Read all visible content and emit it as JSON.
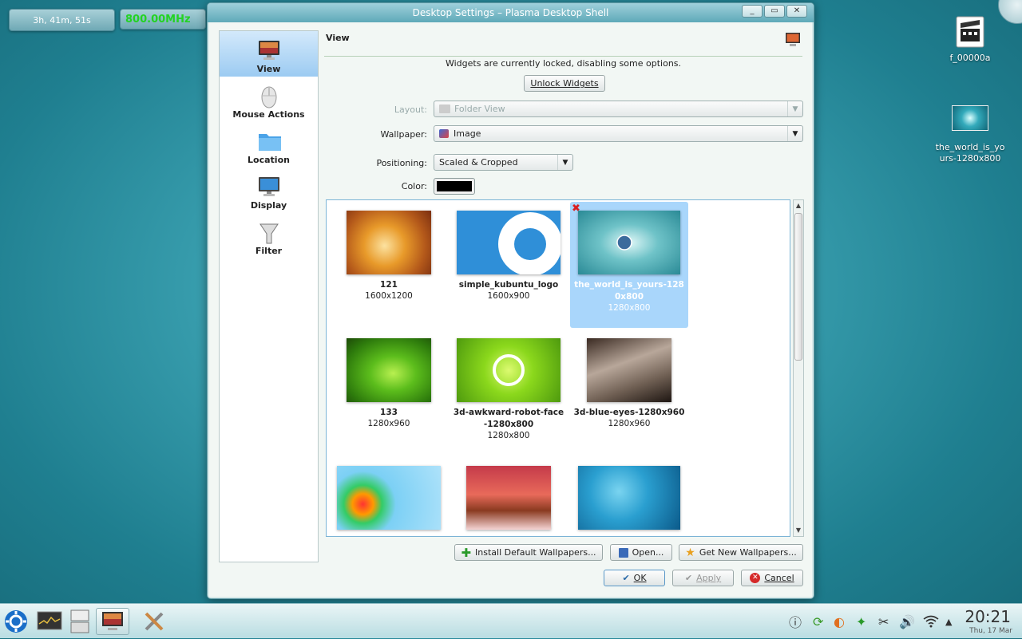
{
  "desktop": {
    "uptime": "3h, 41m, 51s",
    "cpu_freq": "800.00MHz",
    "icons": [
      {
        "label": "f_00000a"
      },
      {
        "label": "the_world_is_yours-1280x800"
      }
    ]
  },
  "dialog": {
    "title": "Desktop Settings – Plasma Desktop Shell",
    "nav": [
      {
        "label": "View",
        "icon": "monitor-icon",
        "active": true
      },
      {
        "label": "Mouse Actions",
        "icon": "mouse-icon"
      },
      {
        "label": "Location",
        "icon": "folder-icon"
      },
      {
        "label": "Display",
        "icon": "display-icon"
      },
      {
        "label": "Filter",
        "icon": "funnel-icon"
      }
    ],
    "page_title": "View",
    "locked_message": "Widgets are currently locked, disabling some options.",
    "unlock_button": "Unlock Widgets",
    "layout_label": "Layout:",
    "layout_value": "Folder View",
    "wallpaper_label": "Wallpaper:",
    "wallpaper_value": "Image",
    "positioning_label": "Positioning:",
    "positioning_value": "Scaled & Cropped",
    "color_label": "Color:",
    "color_value": "#000000",
    "wallpapers": [
      {
        "name": "121",
        "res": "1600x1200"
      },
      {
        "name": "simple_kubuntu_logo",
        "res": "1600x900"
      },
      {
        "name": "the_world_is_yours-1280x800",
        "res": "1280x800",
        "selected": true
      },
      {
        "name": "133",
        "res": "1280x960"
      },
      {
        "name": "3d-awkward-robot-face-1280x800",
        "res": "1280x800"
      },
      {
        "name": "3d-blue-eyes-1280x960",
        "res": "1280x960"
      },
      {
        "name": "",
        "res": ""
      },
      {
        "name": "",
        "res": ""
      },
      {
        "name": "",
        "res": ""
      }
    ],
    "install_button": "Install Default Wallpapers...",
    "open_button": "Open...",
    "get_new_button": "Get New Wallpapers...",
    "ok_button": "OK",
    "apply_button": "Apply",
    "cancel_button": "Cancel"
  },
  "taskbar": {
    "clock_time": "20:21",
    "clock_date": "Thu, 17 Mar"
  }
}
